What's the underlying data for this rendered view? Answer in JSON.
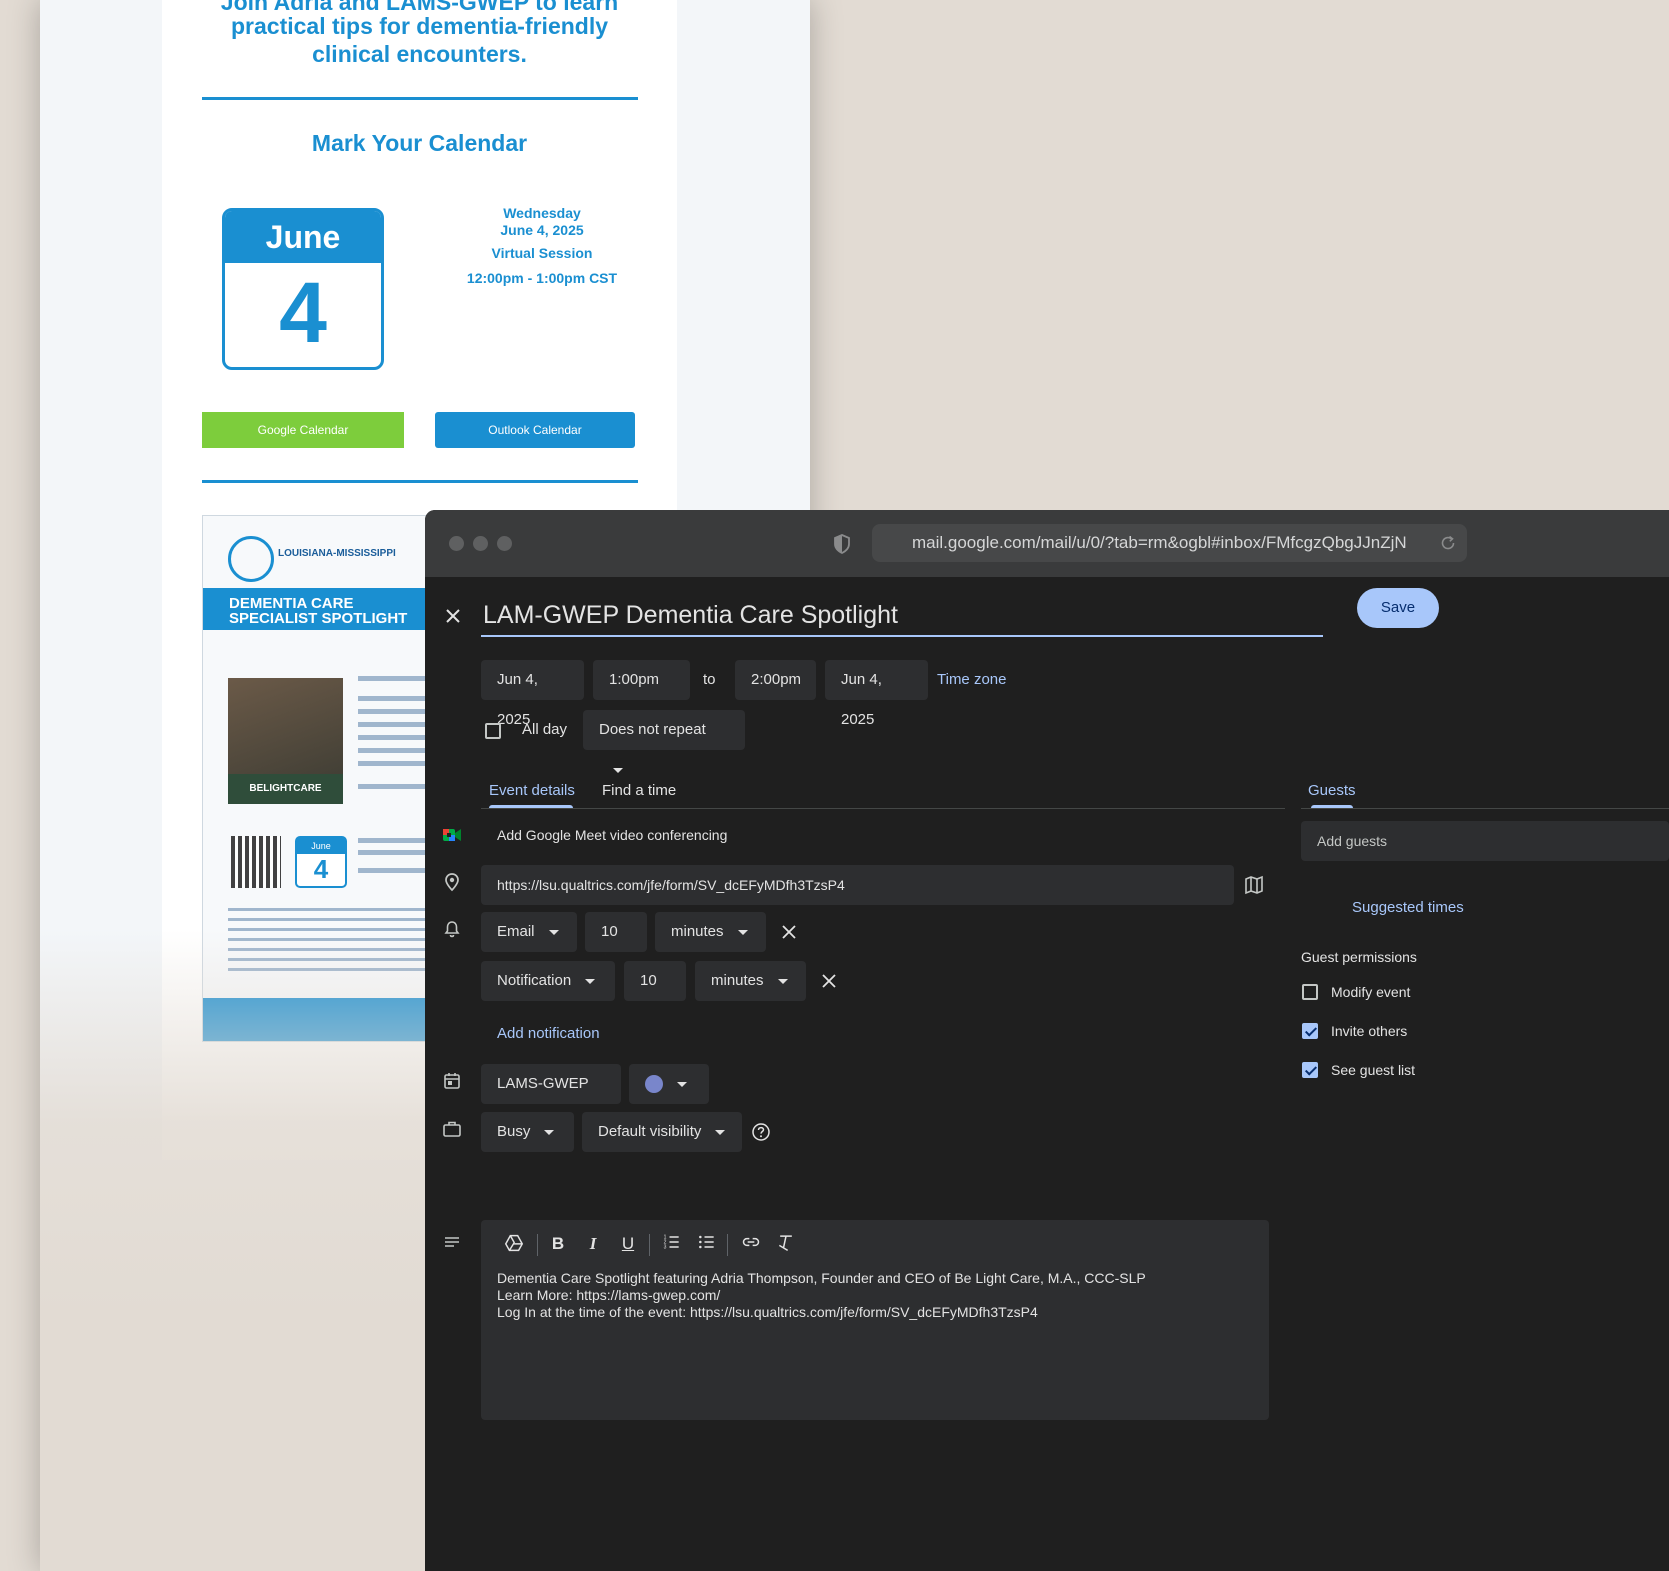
{
  "newsletter": {
    "intro_line1": "Join Adria and LAMS-GWEP to learn",
    "intro_line2": "practical tips for dementia-friendly",
    "intro_line3": "clinical encounters.",
    "mark_calendar": "Mark Your Calendar",
    "cal_month": "June",
    "cal_day": "4",
    "weekday": "Wednesday",
    "date": "June 4, 2025",
    "session": "Virtual Session",
    "time": "12:00pm - 1:00pm CST",
    "google_btn": "Google Calendar",
    "outlook_btn": "Outlook Calendar",
    "flyer": {
      "org": "LOUISIANA-MISSISSIPPI",
      "banner_line1": "DEMENTIA CARE",
      "banner_line2": "SPECIALIST SPOTLIGHT",
      "photo_caption": "BELIGHTCARE",
      "mini_month": "June",
      "mini_day": "4"
    }
  },
  "browser": {
    "url": "mail.google.com/mail/u/0/?tab=rm&ogbl#inbox/FMfcgzQbgJJnZjN"
  },
  "event": {
    "title": "LAM-GWEP Dementia Care Spotlight",
    "save": "Save",
    "start_date": "Jun 4, 2025",
    "start_time": "1:00pm",
    "to": "to",
    "end_time": "2:00pm",
    "end_date": "Jun 4, 2025",
    "timezone": "Time zone",
    "all_day": "All day",
    "repeat": "Does not repeat",
    "tab_details": "Event details",
    "tab_find": "Find a time",
    "meet": "Add Google Meet video conferencing",
    "location": "https://lsu.qualtrics.com/jfe/form/SV_dcEFyMDfh3TzsP4",
    "notif1_type": "Email",
    "notif1_value": "10",
    "notif1_unit": "minutes",
    "notif2_type": "Notification",
    "notif2_value": "10",
    "notif2_unit": "minutes",
    "add_notification": "Add notification",
    "calendar": "LAMS-GWEP",
    "event_color": "#7986cb",
    "busy": "Busy",
    "visibility": "Default visibility",
    "description_line1": "Dementia Care Spotlight featuring Adria Thompson, Founder and CEO of Be Light Care, M.A., CCC-SLP",
    "description_line2": "Learn More: https://lams-gwep.com/",
    "description_line3": "Log In at the time of the event: https://lsu.qualtrics.com/jfe/form/SV_dcEFyMDfh3TzsP4"
  },
  "guests": {
    "tab": "Guests",
    "placeholder": "Add guests",
    "suggested": "Suggested times",
    "permissions_title": "Guest permissions",
    "perm_modify": "Modify event",
    "perm_invite": "Invite others",
    "perm_see": "See guest list"
  }
}
